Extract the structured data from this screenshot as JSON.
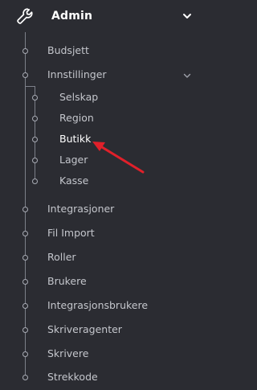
{
  "header": {
    "title": "Admin"
  },
  "menu": {
    "top_items": [
      {
        "label": "Budsjett"
      },
      {
        "label": "Innstillinger"
      }
    ],
    "settings_sub": [
      {
        "label": "Selskap"
      },
      {
        "label": "Region"
      },
      {
        "label": "Butikk"
      },
      {
        "label": "Lager"
      },
      {
        "label": "Kasse"
      }
    ],
    "items": [
      {
        "label": "Integrasjoner"
      },
      {
        "label": "Fil Import"
      },
      {
        "label": "Roller"
      },
      {
        "label": "Brukere"
      },
      {
        "label": "Integrasjonsbrukere"
      },
      {
        "label": "Skriveragenter"
      },
      {
        "label": "Skrivere"
      },
      {
        "label": "Strekkode"
      }
    ]
  },
  "colors": {
    "background": "#2b2c32",
    "text": "#c4c6cc",
    "line": "#7d808a",
    "annotation_arrow": "#e0202a"
  },
  "icons": {
    "header": "wrench-icon",
    "header_toggle": "chevron-down-icon",
    "settings_toggle": "chevron-down-icon",
    "annotation": "red-arrow-annotation"
  }
}
